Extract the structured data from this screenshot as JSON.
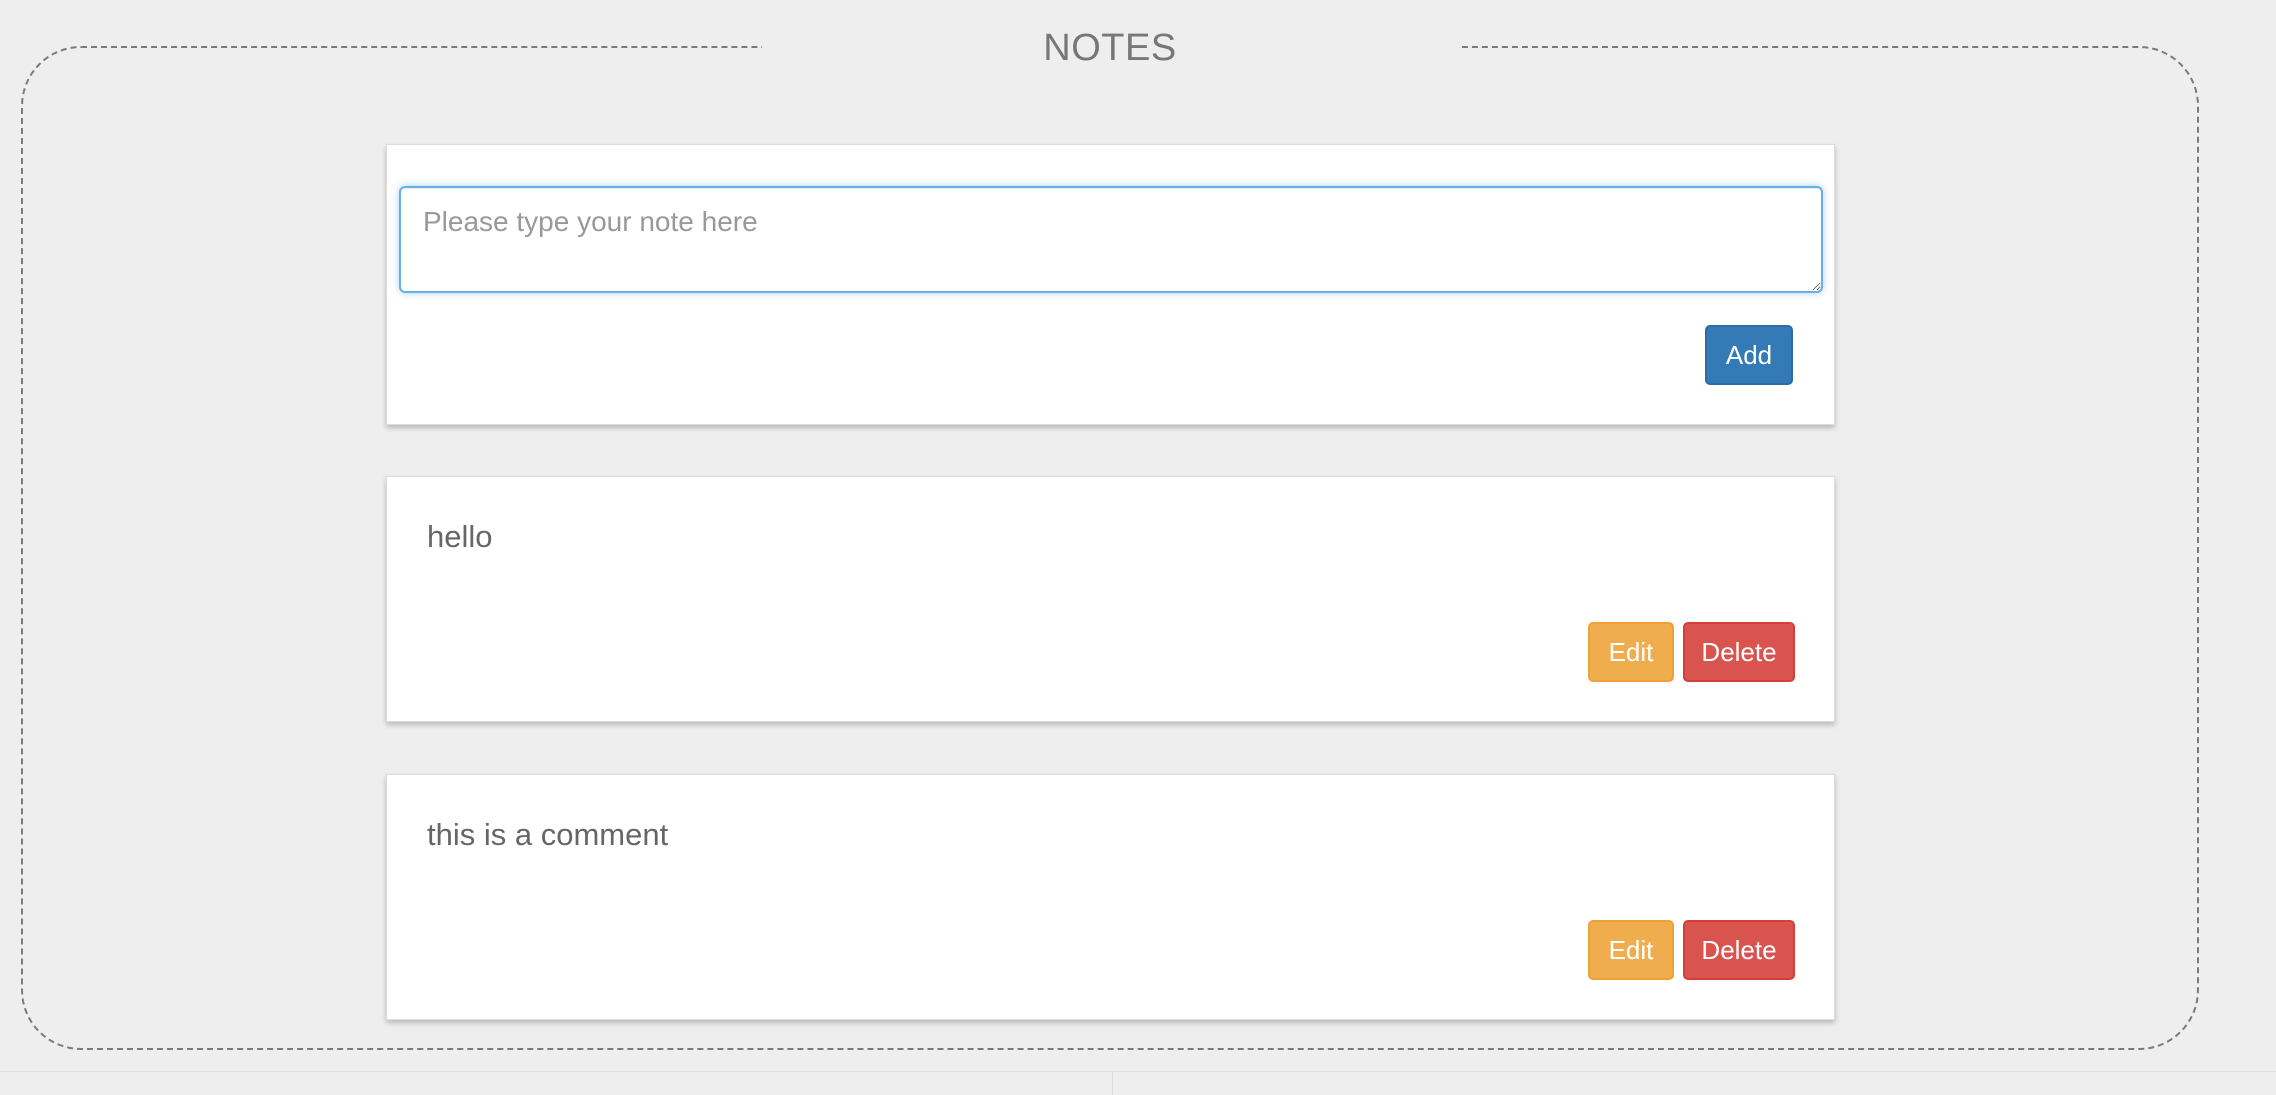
{
  "page": {
    "title": "NOTES"
  },
  "composer": {
    "placeholder": "Please type your note here",
    "value": "",
    "add_label": "Add"
  },
  "notes": [
    {
      "text": "hello",
      "edit_label": "Edit",
      "delete_label": "Delete"
    },
    {
      "text": "this is a comment",
      "edit_label": "Edit",
      "delete_label": "Delete"
    }
  ],
  "colors": {
    "primary": "#337ab7",
    "warning": "#f0ad4e",
    "danger": "#d9534f",
    "focus_border": "#66afe9",
    "background": "#eeeeee"
  }
}
